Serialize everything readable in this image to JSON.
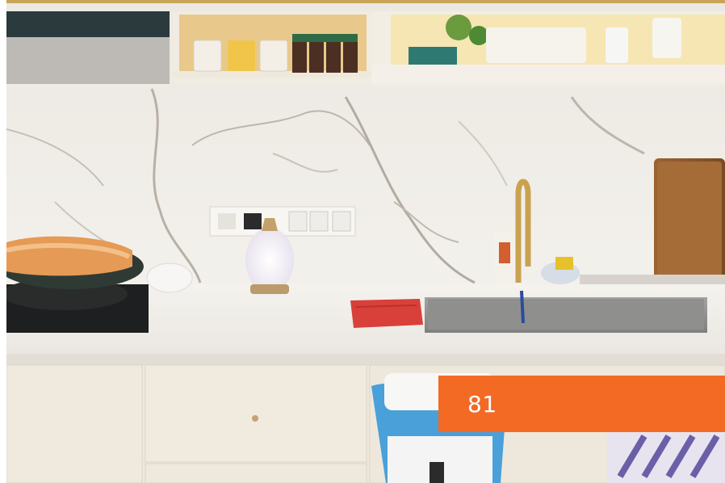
{
  "photo": {
    "subject": "kitchen-counter-scene"
  },
  "badge": {
    "label": "81",
    "color": "#f26a24"
  }
}
